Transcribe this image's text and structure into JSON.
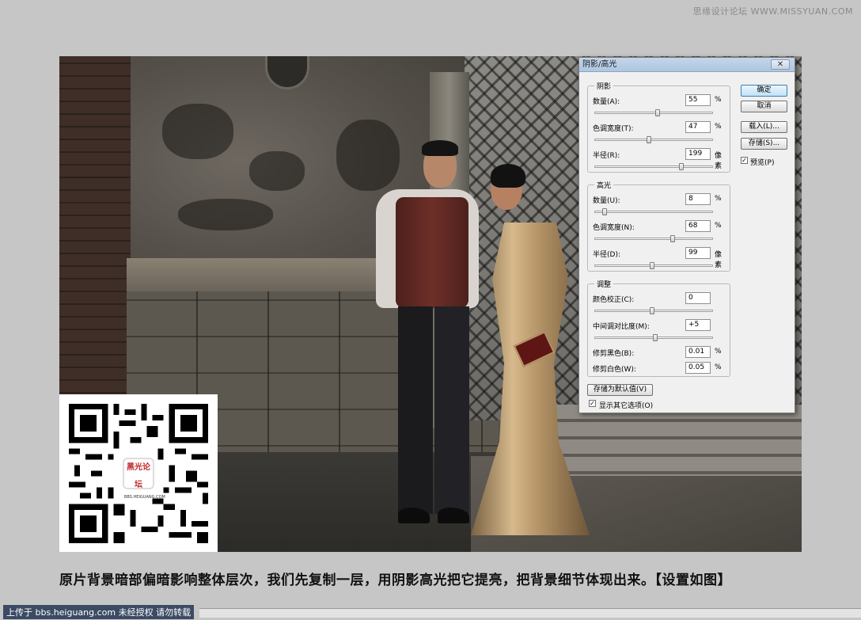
{
  "watermark": "思缘设计论坛 WWW.MISSYUAN.COM",
  "dialog": {
    "title": "阴影/高光",
    "close": "✕",
    "shadows": {
      "title": "阴影",
      "amount": {
        "label": "数量(A):",
        "value": "55",
        "unit": "%",
        "level": 0.55
      },
      "tonal_width": {
        "label": "色调宽度(T):",
        "value": "47",
        "unit": "%",
        "level": 0.47
      },
      "radius": {
        "label": "半径(R):",
        "value": "199",
        "unit": "像素",
        "level": 0.76
      }
    },
    "highlights": {
      "title": "高光",
      "amount": {
        "label": "数量(U):",
        "value": "8",
        "unit": "%",
        "level": 0.08
      },
      "tonal_width": {
        "label": "色调宽度(N):",
        "value": "68",
        "unit": "%",
        "level": 0.68
      },
      "radius": {
        "label": "半径(D):",
        "value": "99",
        "unit": "像素",
        "level": 0.5
      }
    },
    "adjustments": {
      "title": "调整",
      "color_correction": {
        "label": "颜色校正(C):",
        "value": "0",
        "level": 0.5
      },
      "midtone_contrast": {
        "label": "中间调对比度(M):",
        "value": "+5",
        "level": 0.53
      },
      "black_clip": {
        "label": "修剪黑色(B):",
        "value": "0.01",
        "unit": "%"
      },
      "white_clip": {
        "label": "修剪白色(W):",
        "value": "0.05",
        "unit": "%"
      }
    },
    "buttons": {
      "ok": "确定",
      "cancel": "取消",
      "load": "载入(L)...",
      "save": "存储(S)...",
      "preview": "预览(P)",
      "save_default": "存储为默认值(V)",
      "show_more": "显示其它选项(O)"
    }
  },
  "qr_logo": {
    "text": "黑光论坛",
    "sub": "BBS.HEIGUANG.COM"
  },
  "caption": "原片背景暗部偏暗影响整体层次，我们先复制一层，用阴影高光把它提亮，把背景细节体现出来。【设置如图】",
  "footer": {
    "upload": "上传于 bbs.heiguang.com  未经授权  请勿转载"
  }
}
